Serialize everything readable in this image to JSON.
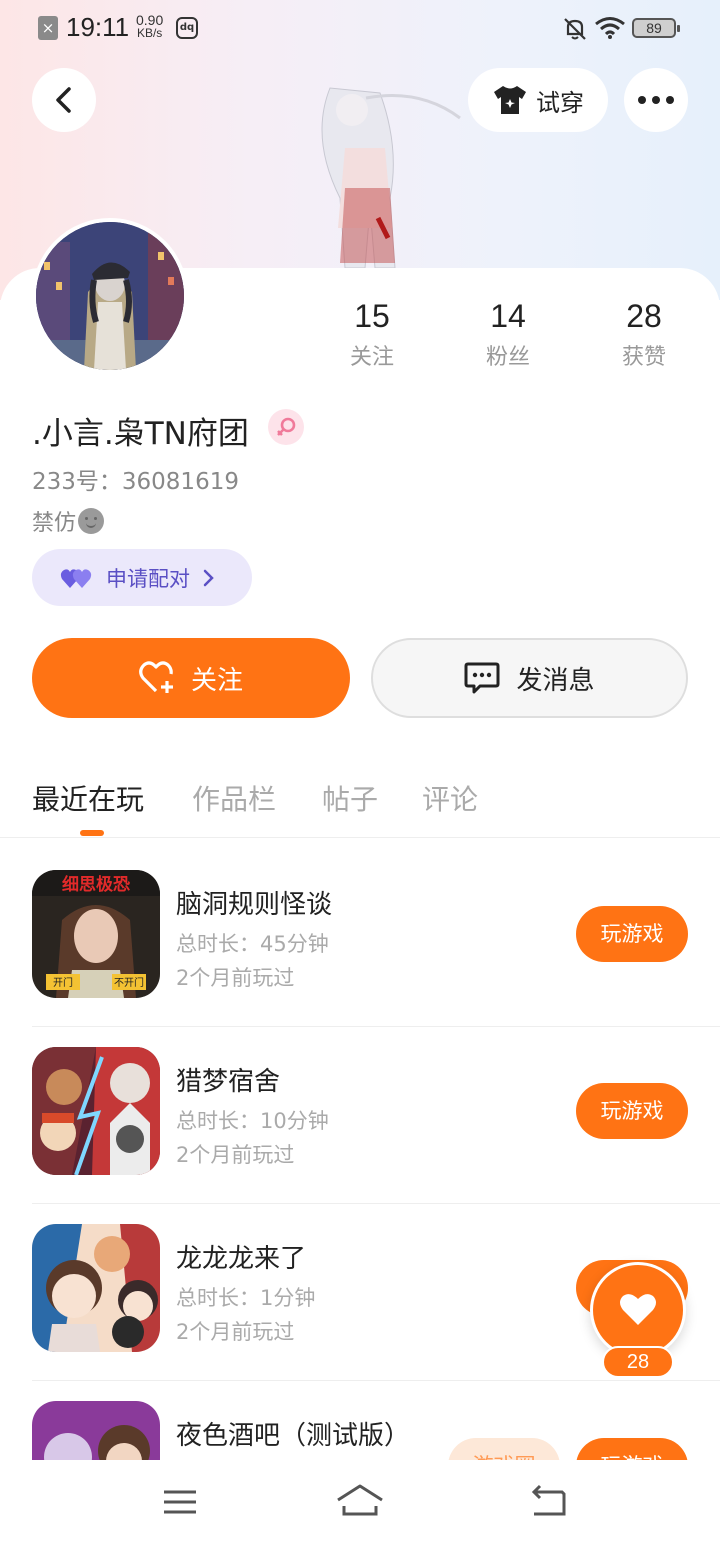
{
  "status_bar": {
    "time": "19:11",
    "net_speed_value": "0.90",
    "net_speed_unit": "KB/s",
    "battery": "89"
  },
  "header": {
    "try_on_label": "试穿"
  },
  "profile": {
    "nickname": ".小言.枭TN府团",
    "uid_line": "233号：36081619",
    "signature": "禁仿",
    "pair_label": "申请配对",
    "stats": [
      {
        "value": "15",
        "label": "关注"
      },
      {
        "value": "14",
        "label": "粉丝"
      },
      {
        "value": "28",
        "label": "获赞"
      }
    ]
  },
  "actions": {
    "follow_label": "关注",
    "message_label": "发消息"
  },
  "tabs": [
    {
      "label": "最近在玩",
      "active": true
    },
    {
      "label": "作品栏",
      "active": false
    },
    {
      "label": "帖子",
      "active": false
    },
    {
      "label": "评论",
      "active": false
    }
  ],
  "games": [
    {
      "title": "脑洞规则怪谈",
      "duration": "总时长：45分钟",
      "last_played": "2个月前玩过",
      "button": "玩游戏",
      "icon_text": "细思极恐",
      "icon_tags": [
        "开门",
        "不开门"
      ]
    },
    {
      "title": "猎梦宿舍",
      "duration": "总时长：10分钟",
      "last_played": "2个月前玩过",
      "button": "玩游戏"
    },
    {
      "title": "龙龙龙来了",
      "duration": "总时长：1分钟",
      "last_played": "2个月前玩过",
      "button": "玩游戏"
    },
    {
      "title": "夜色酒吧（测试版）",
      "tag": "游戏圈",
      "button": "玩游戏"
    }
  ],
  "floating_like": {
    "count": "28"
  },
  "colors": {
    "accent": "#ff7314",
    "pair_bg": "#ebe8fb",
    "pair_text": "#5a4fc4",
    "gender": "#f07a9a"
  }
}
